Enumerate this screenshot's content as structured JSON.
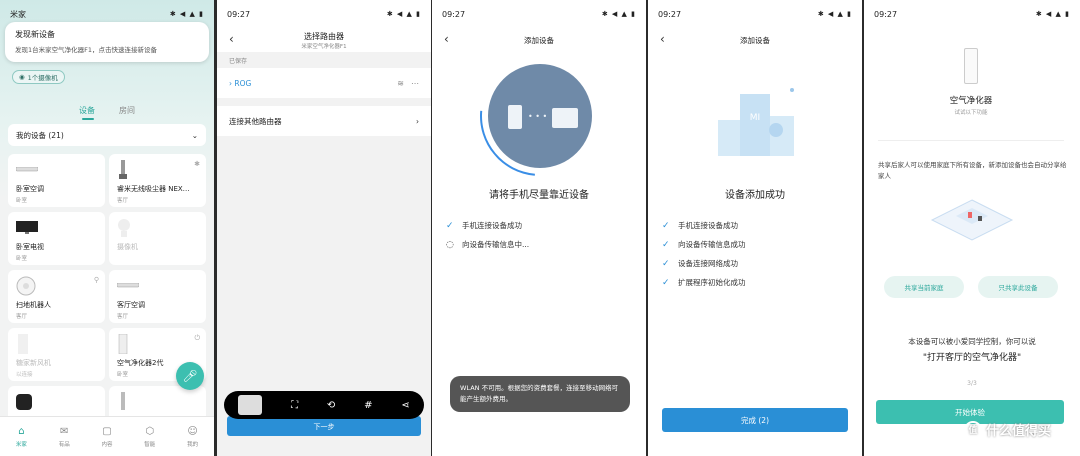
{
  "p1": {
    "status_time": "米家",
    "status_icons": "✱ ◀ ▲ ▮",
    "notification": {
      "title": "发现新设备",
      "body": "发现1台米家空气净化器F1，点击快速连接新设备"
    },
    "camera_pill": "1个摄像机",
    "tabs": {
      "devices": "设备",
      "rooms": "房间"
    },
    "my_devices": "我的设备 (21)",
    "cards": [
      {
        "name": "卧室空调",
        "room": "卧室"
      },
      {
        "name": "睿米无线吸尘器 NEX…",
        "room": "客厅"
      },
      {
        "name": "卧室电视",
        "room": "卧室"
      },
      {
        "name": "摄像机",
        "room": ""
      },
      {
        "name": "扫地机器人",
        "room": "客厅"
      },
      {
        "name": "客厅空调",
        "room": "客厅"
      },
      {
        "name": "糖家新风机",
        "room": "以连接"
      },
      {
        "name": "空气净化器2代",
        "room": "卧室"
      },
      {
        "name": "",
        "room": ""
      },
      {
        "name": "",
        "room": ""
      }
    ],
    "nav": [
      {
        "label": "米家",
        "icon": "⌂"
      },
      {
        "label": "有品",
        "icon": "✉"
      },
      {
        "label": "内容",
        "icon": "▢"
      },
      {
        "label": "智能",
        "icon": "⬡"
      },
      {
        "label": "我的",
        "icon": "☺"
      }
    ]
  },
  "p2": {
    "status_time": "09:27",
    "status_icons": "✱ ◀ ▲ ▮",
    "title": "选择路由器",
    "subtitle": "米家空气净化器F1",
    "saved_label": "已保存",
    "router_name": "ROG",
    "other_router": "连接其他路由器",
    "next_button": "下一步"
  },
  "p3": {
    "status_time": "09:27",
    "status_icons": "✱ ◀ ▲ ▮",
    "title": "添加设备",
    "big_text": "请将手机尽量靠近设备",
    "steps": [
      "手机连接设备成功",
      "向设备传输信息中..."
    ],
    "toast": "WLAN 不可用。根据您的资费套餐，连接至移动网络可能产生额外费用。"
  },
  "p4": {
    "status_time": "09:27",
    "status_icons": "✱ ◀ ▲ ▮",
    "title": "添加设备",
    "big_text": "设备添加成功",
    "steps": [
      "手机连接设备成功",
      "向设备传输信息成功",
      "设备连接网络成功",
      "扩展程序初始化成功"
    ],
    "done_button": "完成 (2)"
  },
  "p5": {
    "status_time": "09:27",
    "status_icons": "✱ ◀ ▲ ▮",
    "device_name": "空气净化器",
    "device_sub": "试试以下功能",
    "share_text": "共享后家人可以使用家庭下所有设备，新添加设备也会自动分享给家人",
    "share_current": "共享当前家庭",
    "share_only": "只共享此设备",
    "voice_line1": "本设备可以被小爱同学控制，你可以说",
    "voice_line2": "\"打开客厅的空气净化器\"",
    "page_indicator": "3/3",
    "start_button": "开始体验",
    "watermark": "什么值得买"
  },
  "colors": {
    "mi_teal": "#2aa79b",
    "mi_blue": "#2a8fd6"
  }
}
